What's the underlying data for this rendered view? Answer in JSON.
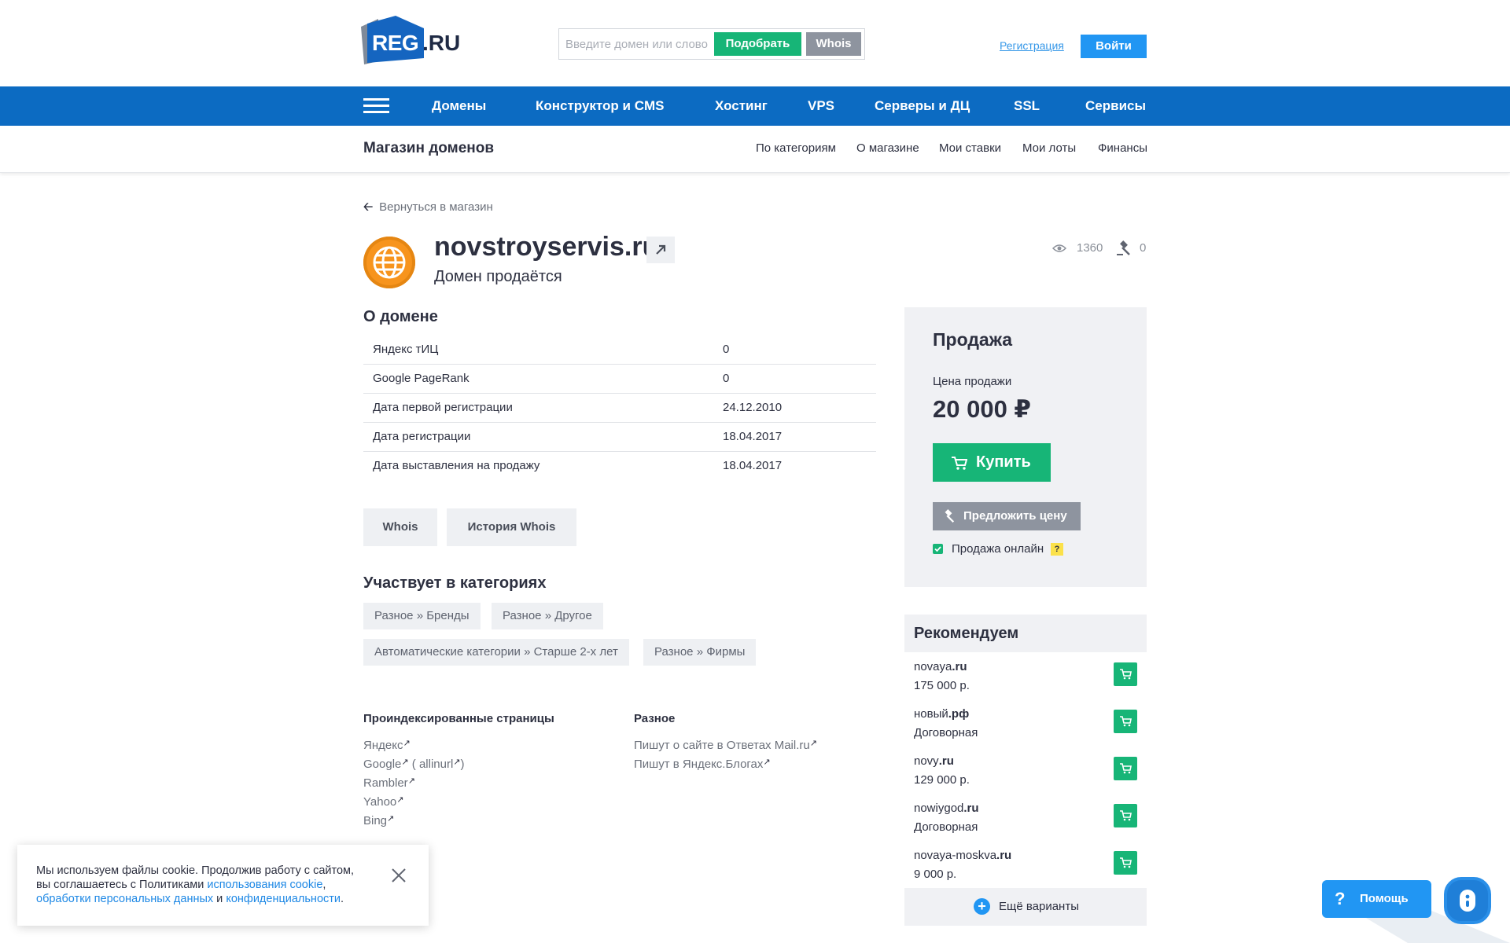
{
  "header": {
    "logo_text": "REG",
    "logo_suffix": ".RU",
    "search_placeholder": "Введите домен или слово",
    "search_button": "Подобрать",
    "whois_button": "Whois",
    "register_link": "Регистрация",
    "login_button": "Войти"
  },
  "nav": {
    "items": [
      "Домены",
      "Конструктор и CMS",
      "Хостинг",
      "VPS",
      "Серверы и ДЦ",
      "SSL",
      "Сервисы"
    ]
  },
  "subnav": {
    "title": "Магазин доменов",
    "links": [
      "По категориям",
      "О магазине",
      "Мои ставки",
      "Мои лоты",
      "Финансы"
    ]
  },
  "back_link": "Вернуться в магазин",
  "domain": {
    "name": "novstroyservis.ru",
    "status": "Домен продаётся",
    "views": "1360",
    "bids": "0"
  },
  "about": {
    "title": "О домене",
    "rows": [
      {
        "label": "Яндекс тИЦ",
        "value": "0"
      },
      {
        "label": "Google PageRank",
        "value": "0"
      },
      {
        "label": "Дата первой регистрации",
        "value": "24.12.2010"
      },
      {
        "label": "Дата регистрации",
        "value": "18.04.2017"
      },
      {
        "label": "Дата выставления на продажу",
        "value": "18.04.2017"
      }
    ],
    "whois_button": "Whois",
    "whois_history_button": "История Whois"
  },
  "categories": {
    "title": "Участвует в категориях",
    "tags": [
      "Разное » Бренды",
      "Разное » Другое",
      "Автоматические категории » Старше 2-х лет",
      "Разное » Фирмы"
    ]
  },
  "indexed": {
    "title": "Проиндексированные страницы",
    "links": [
      "Яндекс",
      "Google",
      "Rambler",
      "Yahoo",
      "Bing"
    ],
    "google_extra_open": "(",
    "google_extra": "allinurl",
    "google_extra_close": ")"
  },
  "misc": {
    "title": "Разное",
    "links": [
      "Пишут о сайте в Ответах Mail.ru",
      "Пишут в Яндекс.Блогах"
    ]
  },
  "sale": {
    "title": "Продажа",
    "price_label": "Цена продажи",
    "price": "20 000 ₽",
    "buy_button": "Купить",
    "offer_button": "Предложить цену",
    "online_label": "Продажа онлайн",
    "help_mark": "?"
  },
  "recommended": {
    "title": "Рекомендуем",
    "items": [
      {
        "name": "novaya",
        "tld": ".ru",
        "price": "175 000 р."
      },
      {
        "name": "новый",
        "tld": ".рф",
        "price": "Договорная"
      },
      {
        "name": "novy",
        "tld": ".ru",
        "price": "129 000 р."
      },
      {
        "name": "nowiygod",
        "tld": ".ru",
        "price": "Договорная"
      },
      {
        "name": "novaya-moskva",
        "tld": ".ru",
        "price": "9 000 р."
      }
    ],
    "more": "Ещё варианты"
  },
  "cookie": {
    "line1": "Мы используем файлы cookie. Продолжив работу с сайтом,",
    "line2": "вы соглашаетесь с Политиками ",
    "link1": "использования cookie",
    "comma": ",",
    "link2": "обработки персональных данных",
    "and": " и ",
    "link3": "конфиденциальности",
    "dot": "."
  },
  "help": {
    "label": "Помощь",
    "mark": "?"
  },
  "colors": {
    "brand_blue": "#0c6bc2",
    "green": "#17b577",
    "gray_button": "#8e949f",
    "globe_orange": "#f7941d"
  }
}
